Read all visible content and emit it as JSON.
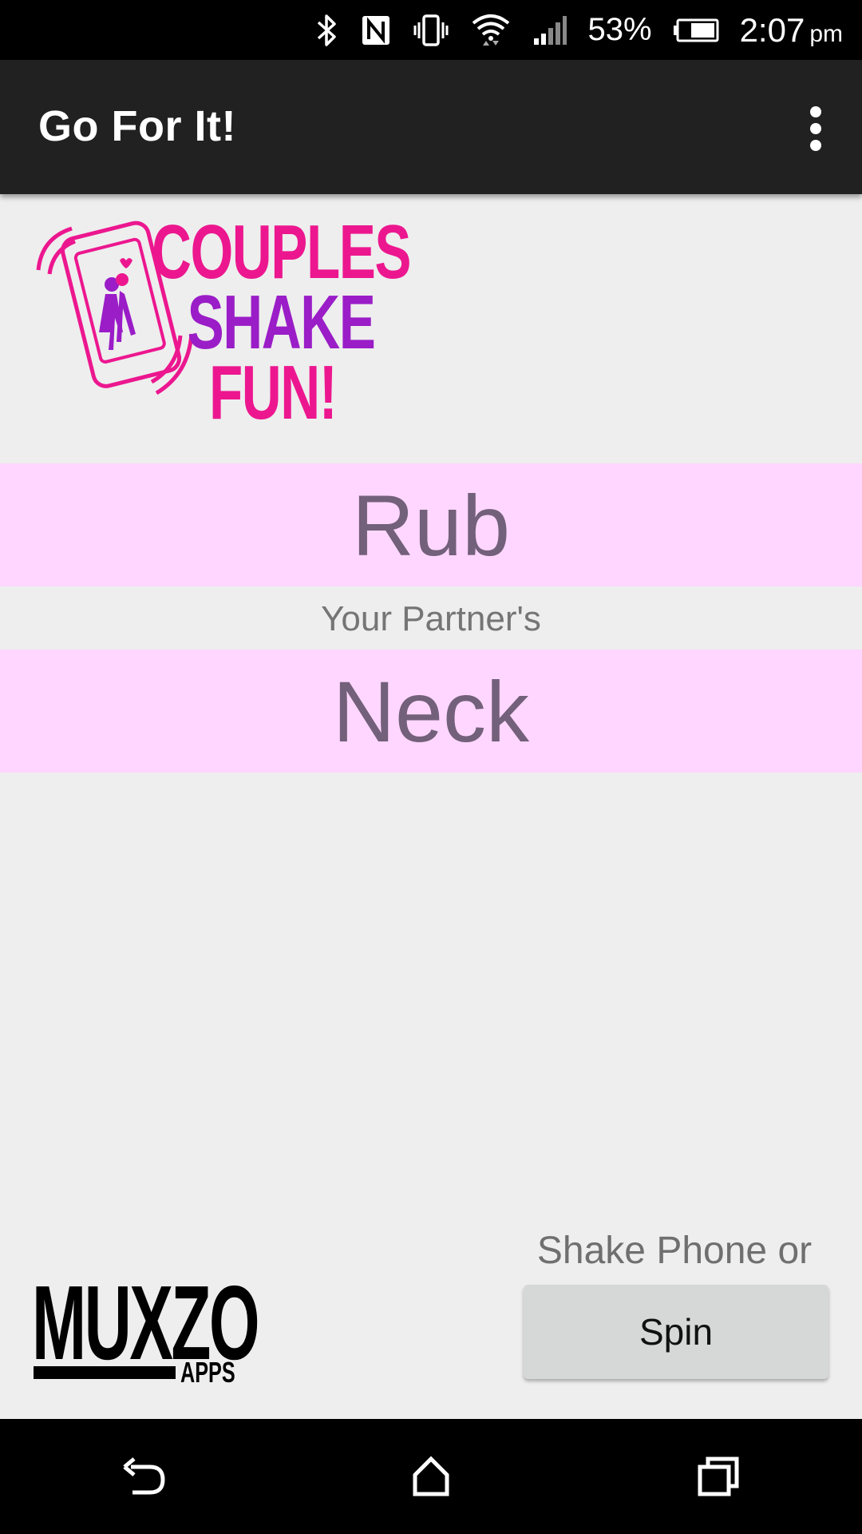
{
  "status_bar": {
    "battery_percent": "53%",
    "time": "2:07",
    "ampm": "pm",
    "icons": [
      "bluetooth-icon",
      "nfc-icon",
      "vibrate-icon",
      "wifi-icon",
      "signal-icon",
      "battery-icon"
    ]
  },
  "app_bar": {
    "title": "Go For It!"
  },
  "logo": {
    "line1": "COUPLES",
    "line2": "SHAKE",
    "line3": "FUN!"
  },
  "result": {
    "action": "Rub",
    "connector": "Your Partner's",
    "body_part": "Neck"
  },
  "footer": {
    "brand_word": "MUXZO",
    "brand_sub": "APPS",
    "shake_hint": "Shake Phone or",
    "spin_label": "Spin"
  },
  "colors": {
    "band_background": "#ffd6ff",
    "band_text": "#73607a",
    "logo_pink": "#ec178f",
    "logo_purple": "#9a1dc7",
    "app_bar": "#212121",
    "background": "#eeeeee"
  }
}
